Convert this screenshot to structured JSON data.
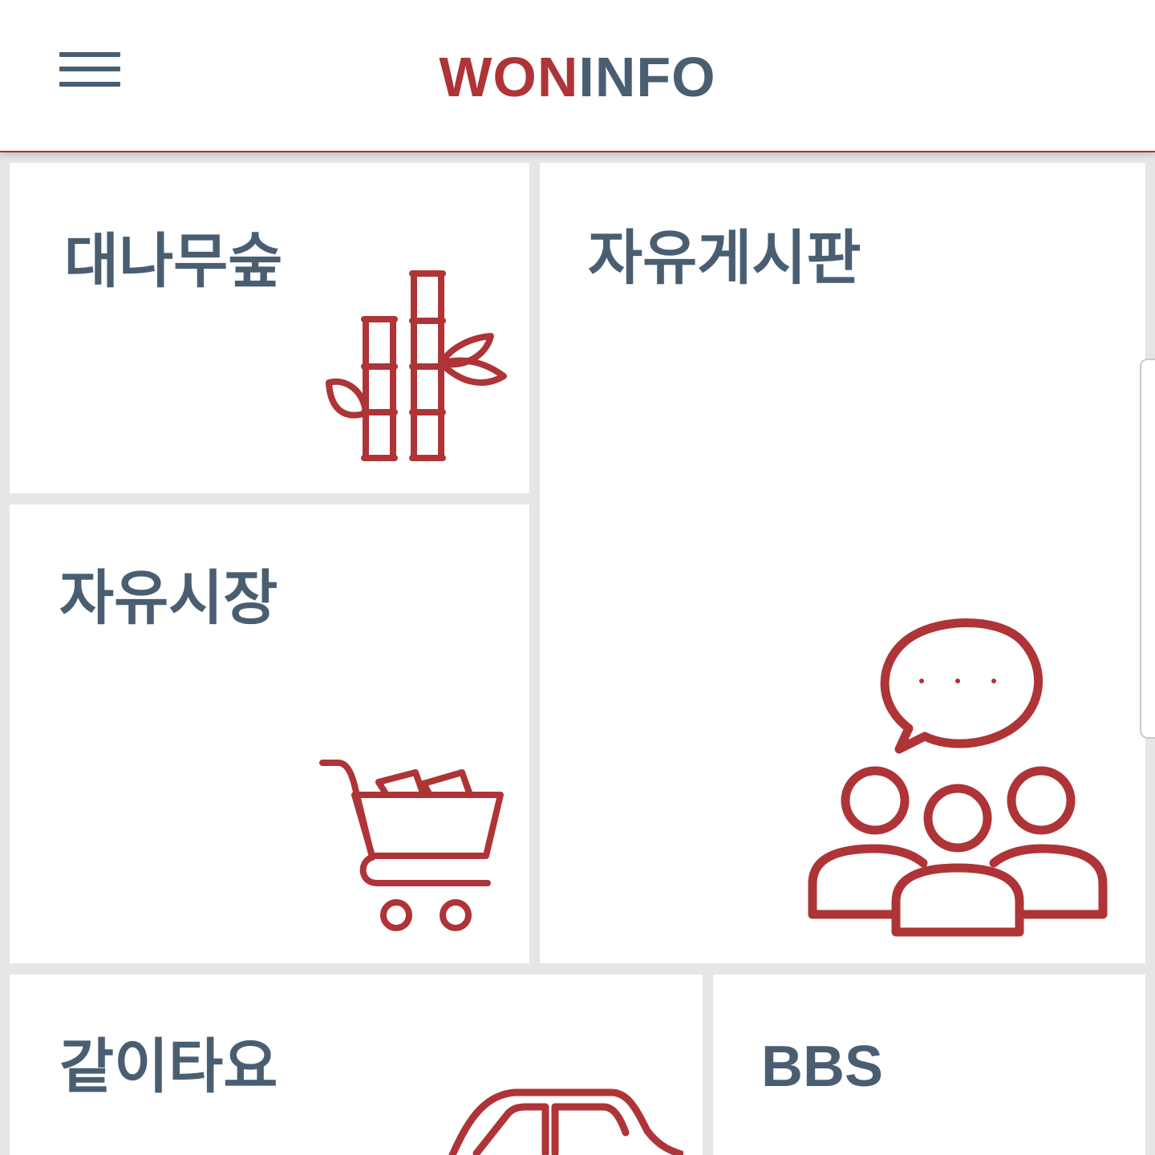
{
  "header": {
    "logo_red": "WON",
    "logo_slate": "INFO",
    "menu_icon": "hamburger-menu-icon"
  },
  "tiles": {
    "bamboo": {
      "title": "대나무숲",
      "icon": "bamboo-icon"
    },
    "free_board": {
      "title": "자유게시판",
      "icon": "group-chat-icon"
    },
    "free_market": {
      "title": "자유시장",
      "icon": "shopping-cart-icon"
    },
    "carpool": {
      "title": "같이타요",
      "icon": "car-icon"
    },
    "bbs": {
      "title": "BBS"
    }
  },
  "colors": {
    "accent": "#ae3437",
    "text": "#4a5e72",
    "background": "#e6e6e6",
    "tile": "#ffffff"
  }
}
